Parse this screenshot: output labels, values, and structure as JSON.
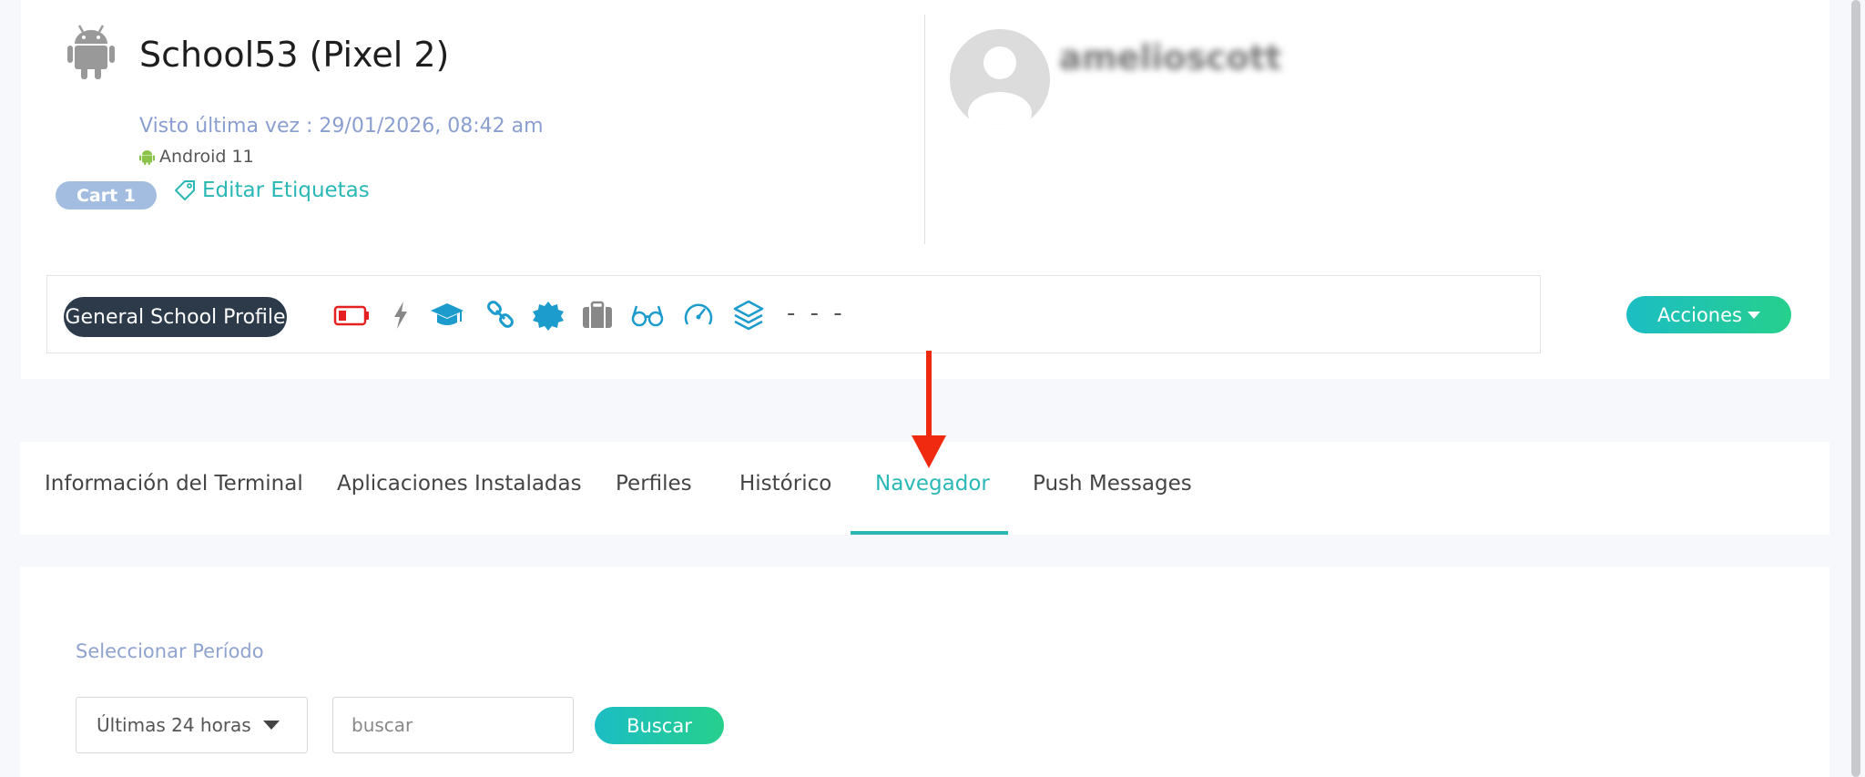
{
  "device": {
    "name": "School53 (Pixel 2)",
    "last_seen": "Visto última vez : 29/01/2026, 08:42 am",
    "os": "Android 11",
    "tag": "Cart 1",
    "edit_tags_label": "Editar Etiquetas"
  },
  "user": {
    "username": "amelioscott"
  },
  "status_bar": {
    "profile": "General School Profile",
    "icons": [
      "battery-low-icon",
      "bolt-icon",
      "graduation-cap-icon",
      "link-icon",
      "certificate-icon",
      "briefcase-icon",
      "glasses-icon",
      "speedometer-icon",
      "layers-icon"
    ],
    "dashes": "- - -"
  },
  "actions": {
    "label": "Acciones"
  },
  "tabs": [
    {
      "label": "Información del Terminal",
      "active": false
    },
    {
      "label": "Aplicaciones Instaladas",
      "active": false
    },
    {
      "label": "Perfiles",
      "active": false
    },
    {
      "label": "Histórico",
      "active": false
    },
    {
      "label": "Navegador",
      "active": true
    },
    {
      "label": "Push Messages",
      "active": false
    }
  ],
  "filters": {
    "period_label": "Seleccionar Período",
    "period_value": "Últimas 24 horas",
    "search_placeholder": "buscar",
    "search_button": "Buscar"
  },
  "colors": {
    "accent": "#2ab8b6",
    "tag": "#a3bde0",
    "profile_pill": "#2d3a4a",
    "annotation_arrow": "#f02a10",
    "battery": "#e62020",
    "icon": "#1c9ccc"
  }
}
